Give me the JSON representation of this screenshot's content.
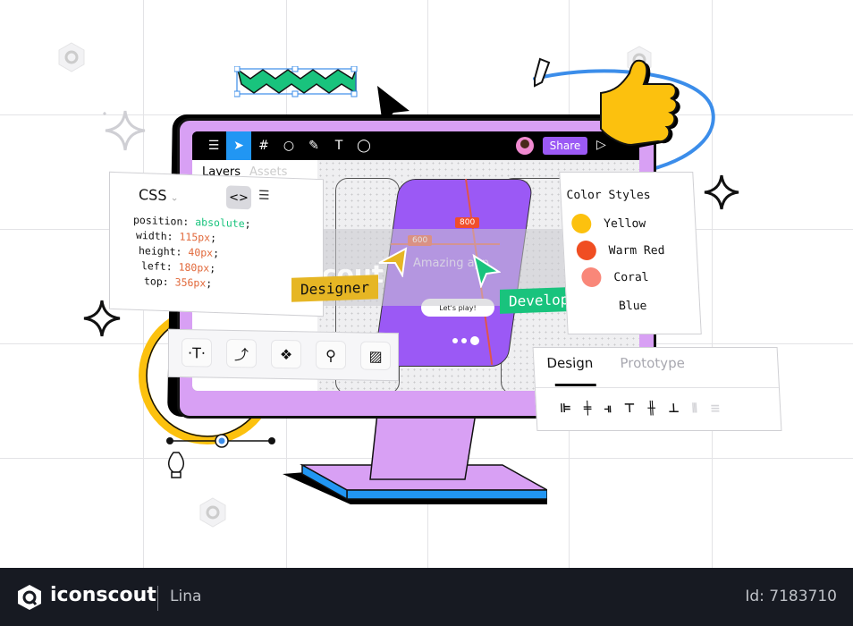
{
  "toolbar": {
    "icons": [
      "menu-icon",
      "cursor-icon",
      "frame-icon",
      "ellipse-icon",
      "pen-icon",
      "text-icon",
      "comment-icon"
    ],
    "share_label": "Share"
  },
  "left_panel": {
    "tabs": [
      "Layers",
      "Assets"
    ]
  },
  "css_panel": {
    "title": "CSS",
    "lines": [
      {
        "prop": "position:",
        "value": "absolute",
        "suffix": ";"
      },
      {
        "prop": "width:",
        "value": "115px",
        "suffix": ";"
      },
      {
        "prop": "height:",
        "value": "40px",
        "suffix": ";"
      },
      {
        "prop": "left:",
        "value": "180px",
        "suffix": ";"
      },
      {
        "prop": "top:",
        "value": "356px",
        "suffix": ";"
      }
    ]
  },
  "phone": {
    "title": "Amazing app",
    "cta": "Let's play!",
    "measure_h": "600",
    "measure_v": "800"
  },
  "tags": {
    "designer": "Designer",
    "developer": "Developer"
  },
  "color_styles": {
    "title": "Color Styles",
    "items": [
      {
        "name": "Yellow",
        "color": "#fcc10e"
      },
      {
        "name": "Warm Red",
        "color": "#f04e22"
      },
      {
        "name": "Coral",
        "color": "#f98779"
      },
      {
        "name": "Blue",
        "color": "#ffffff"
      }
    ]
  },
  "design_panel": {
    "tabs": [
      "Design",
      "Prototype"
    ],
    "active_tab": "Design"
  },
  "watermark": {
    "brand": "iconscout",
    "author": "Lina"
  },
  "footer": {
    "brand": "iconscout",
    "author": "Lina",
    "id": "Id: 7183710"
  },
  "colors": {
    "monitor": "#d8a0f4",
    "accent_purple": "#9b59f5",
    "accent_blue": "#2196f3",
    "accent_green": "#19c37d",
    "accent_yellow": "#fcc10e"
  }
}
